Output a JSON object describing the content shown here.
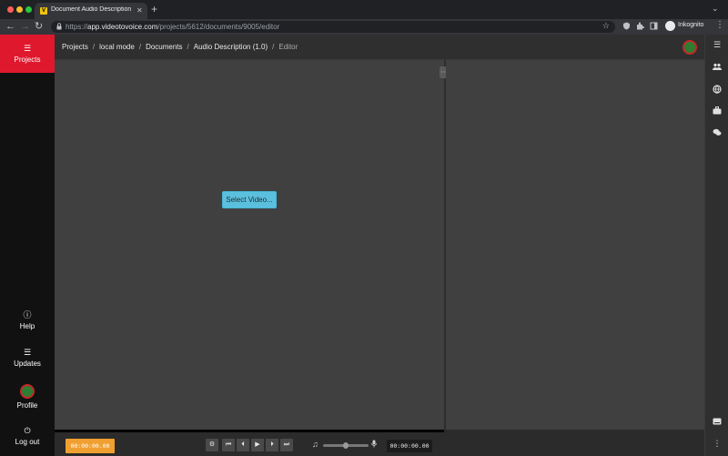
{
  "browser": {
    "tab_title": "Document Audio Description",
    "tab_favicon": "V",
    "url_prefix": "https://",
    "url_host": "app.videotovoice.com",
    "url_path": "/projects/5612/documents/9005/editor",
    "profile_label": "Inkognito"
  },
  "sidebar": {
    "projects_label": "Projects",
    "help_label": "Help",
    "updates_label": "Updates",
    "profile_label": "Profile",
    "logout_label": "Log out"
  },
  "breadcrumb": {
    "items": [
      "Projects",
      "local mode",
      "Documents",
      "Audio Description (1.0)"
    ],
    "current": "Editor",
    "separator": "/"
  },
  "editor": {
    "select_video_label": "Select Video..."
  },
  "player": {
    "current_time": "00:00:00.00",
    "duration": "00:00:00.00",
    "volume": 0.5
  },
  "colors": {
    "accent_red": "#e0182d",
    "timecode_orange": "#f0a030",
    "select_button": "#5bc0de"
  }
}
